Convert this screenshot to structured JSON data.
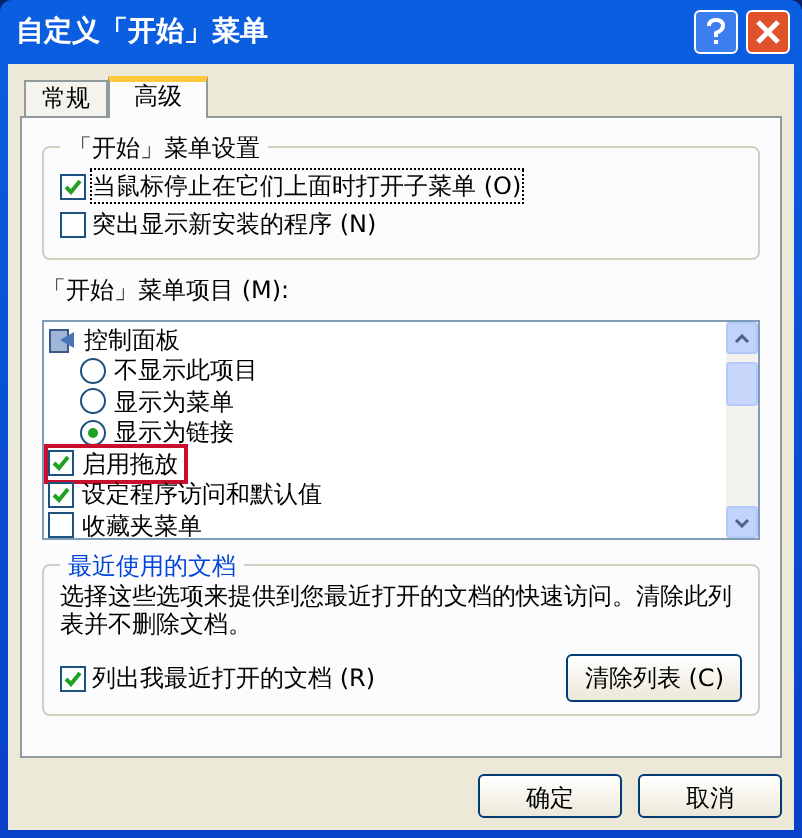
{
  "window": {
    "title": "自定义「开始」菜单"
  },
  "tabs": [
    {
      "label": "常规",
      "selected": false
    },
    {
      "label": "高级",
      "selected": true
    }
  ],
  "start_menu_settings": {
    "title": "「开始」菜单设置",
    "options": [
      {
        "label": "当鼠标停止在它们上面时打开子菜单 (O)",
        "checked": true,
        "focused": true
      },
      {
        "label": "突出显示新安装的程序 (N)",
        "checked": false,
        "focused": false
      }
    ]
  },
  "start_menu_items": {
    "label": "「开始」菜单项目 (M):",
    "items": [
      {
        "kind": "folder",
        "label": "控制面板",
        "children": [
          {
            "kind": "radio",
            "label": "不显示此项目",
            "selected": false
          },
          {
            "kind": "radio",
            "label": "显示为菜单",
            "selected": false
          },
          {
            "kind": "radio",
            "label": "显示为链接",
            "selected": true
          }
        ]
      },
      {
        "kind": "check",
        "label": "启用拖放",
        "checked": true,
        "highlighted": true
      },
      {
        "kind": "check",
        "label": "设定程序访问和默认值",
        "checked": true,
        "highlighted": false
      },
      {
        "kind": "check",
        "label": "收藏夹菜单",
        "checked": false,
        "highlighted": false
      }
    ]
  },
  "recent_documents": {
    "title": "最近使用的文档",
    "description": "选择这些选项来提供到您最近打开的文档的快速访问。清除此列表并不删除文档。",
    "option": {
      "label": "列出我最近打开的文档 (R)",
      "checked": true
    },
    "clear_button": "清除列表 (C)"
  },
  "buttons": [
    "确定",
    "取消"
  ]
}
